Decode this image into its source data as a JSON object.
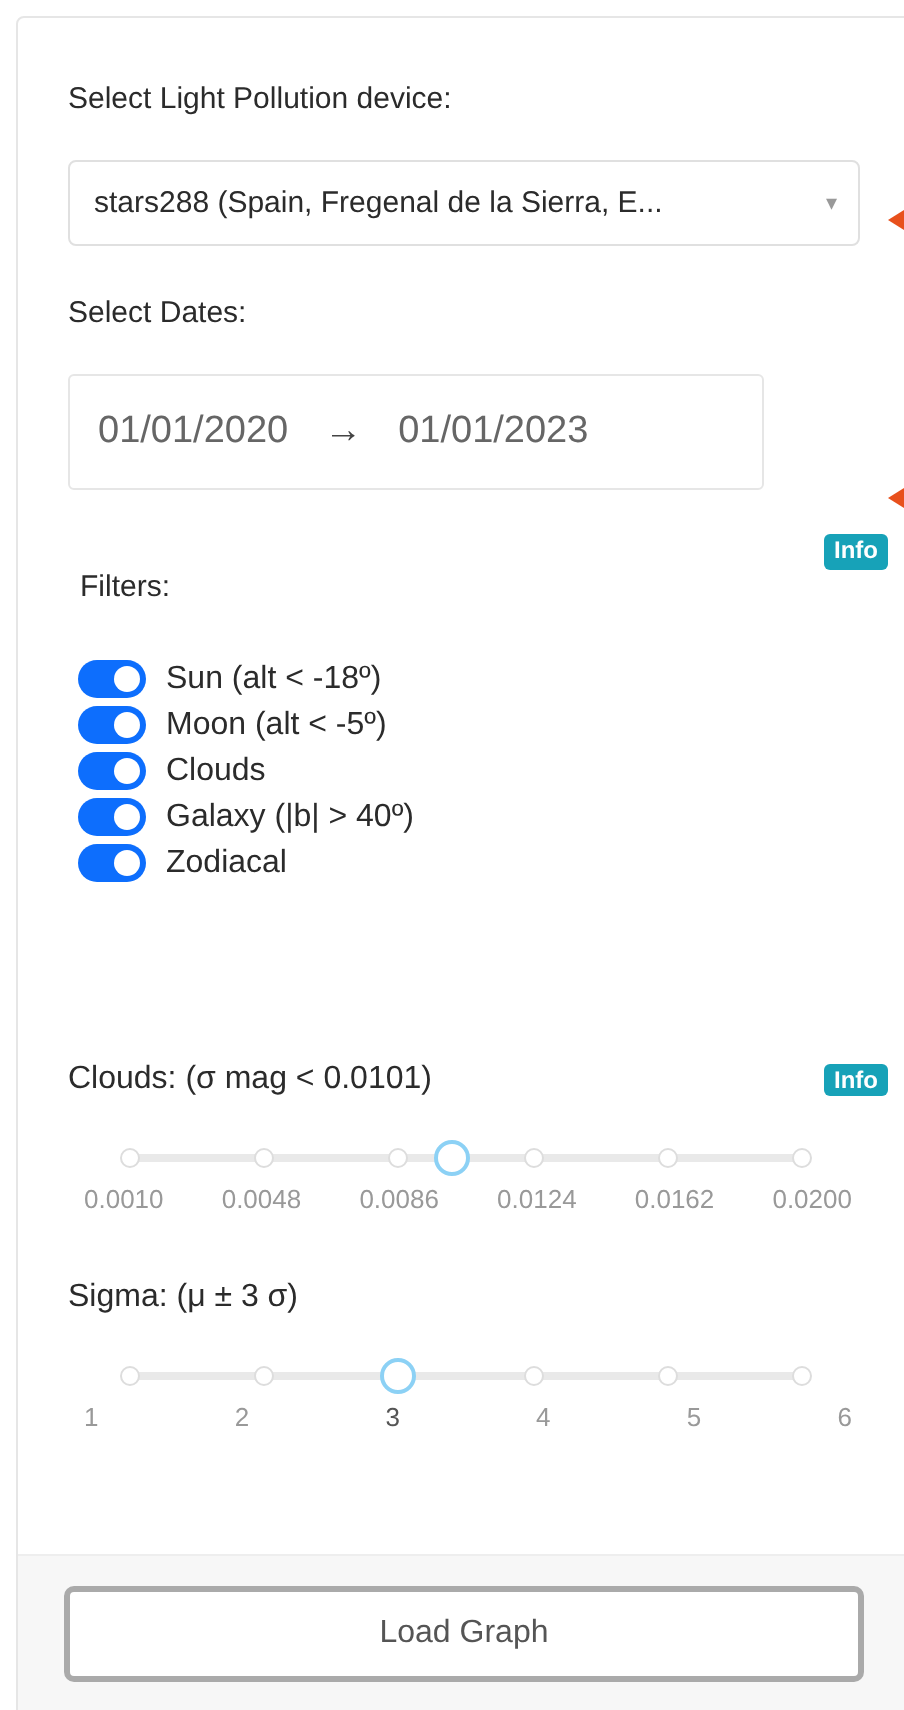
{
  "device": {
    "label": "Select Light Pollution device:",
    "value": "stars288 (Spain, Fregenal de la Sierra, E...",
    "caret": "▾"
  },
  "dates": {
    "label": "Select Dates:",
    "start": "01/01/2020",
    "arrow": "→",
    "end": "01/01/2023"
  },
  "filters": {
    "info": "Info",
    "label": "Filters:",
    "items": [
      {
        "label": "Sun (alt < -18º)",
        "on": true
      },
      {
        "label": "Moon (alt < -5º)",
        "on": true
      },
      {
        "label": "Clouds",
        "on": true
      },
      {
        "label": "Galaxy (|b| > 40º)",
        "on": true
      },
      {
        "label": "Zodiacal",
        "on": true
      }
    ]
  },
  "sliders": [
    {
      "label": "Clouds:  (σ mag < 0.0101)",
      "info": "Info",
      "level": 0.478,
      "ticks": [
        "0.0010",
        "0.0048",
        "0.0086",
        "0.0124",
        "0.0162",
        "0.0200"
      ]
    },
    {
      "label": "Sigma:  (μ ± 3 σ)",
      "level": 0.4,
      "ticks": [
        "1",
        "2",
        "3",
        "4",
        "5",
        "6"
      ]
    }
  ],
  "button": "Load Graph"
}
